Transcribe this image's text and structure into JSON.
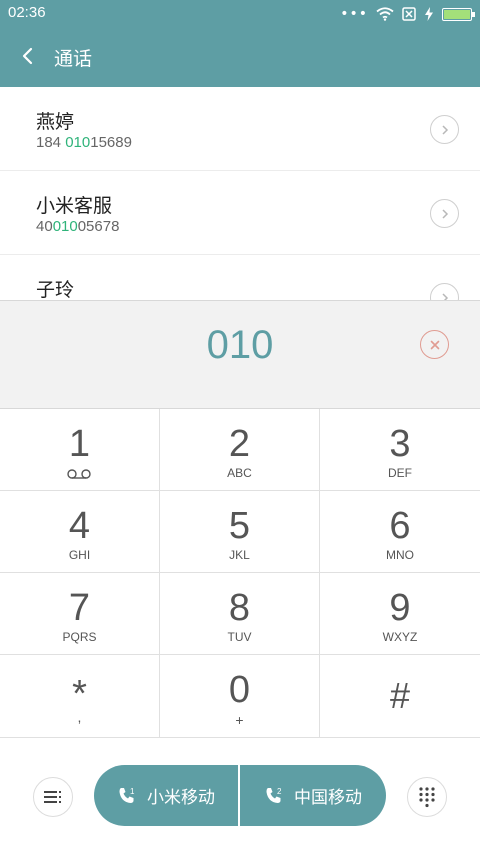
{
  "status_bar": {
    "time": "02:36",
    "icons": [
      "more-dots-icon",
      "wifi-icon",
      "no-sim-icon",
      "charging-icon",
      "battery-icon"
    ],
    "dots": "•••"
  },
  "header": {
    "title": "通话",
    "back_icon": "chevron-left-icon"
  },
  "contacts": [
    {
      "name": "燕婷",
      "number_pre": "184 ",
      "number_match": "010",
      "number_post": "15689"
    },
    {
      "name": "小米客服",
      "number_pre": "40",
      "number_match": "010",
      "number_post": "05678"
    },
    {
      "name": "子玲",
      "number_pre": "",
      "number_match": "",
      "number_post": ""
    }
  ],
  "dial_display": {
    "digits": "010",
    "clear_icon": "clear-circle-icon"
  },
  "keypad": [
    {
      "digit": "1",
      "letters": "",
      "sub_icon": "voicemail-icon"
    },
    {
      "digit": "2",
      "letters": "ABC"
    },
    {
      "digit": "3",
      "letters": "DEF"
    },
    {
      "digit": "4",
      "letters": "GHI"
    },
    {
      "digit": "5",
      "letters": "JKL"
    },
    {
      "digit": "6",
      "letters": "MNO"
    },
    {
      "digit": "7",
      "letters": "PQRS"
    },
    {
      "digit": "8",
      "letters": "TUV"
    },
    {
      "digit": "9",
      "letters": "WXYZ"
    },
    {
      "digit": "*",
      "letters": ","
    },
    {
      "digit": "0",
      "letters": "+"
    },
    {
      "digit": "#",
      "letters": ""
    }
  ],
  "bottom_bar": {
    "sim1_label": "小米移动",
    "sim2_label": "中国移动",
    "sim1_icon": "phone-sim1-icon",
    "sim2_icon": "phone-sim2-icon",
    "sim1_number": "1",
    "sim2_number": "2",
    "menu_icon": "menu-list-icon",
    "dialpad_icon": "dialpad-grid-icon"
  },
  "colors": {
    "accent": "#5e9ea4",
    "match_highlight": "#2fb37a",
    "clear_button": "#e09c92",
    "battery_fill": "#a3e07a"
  }
}
